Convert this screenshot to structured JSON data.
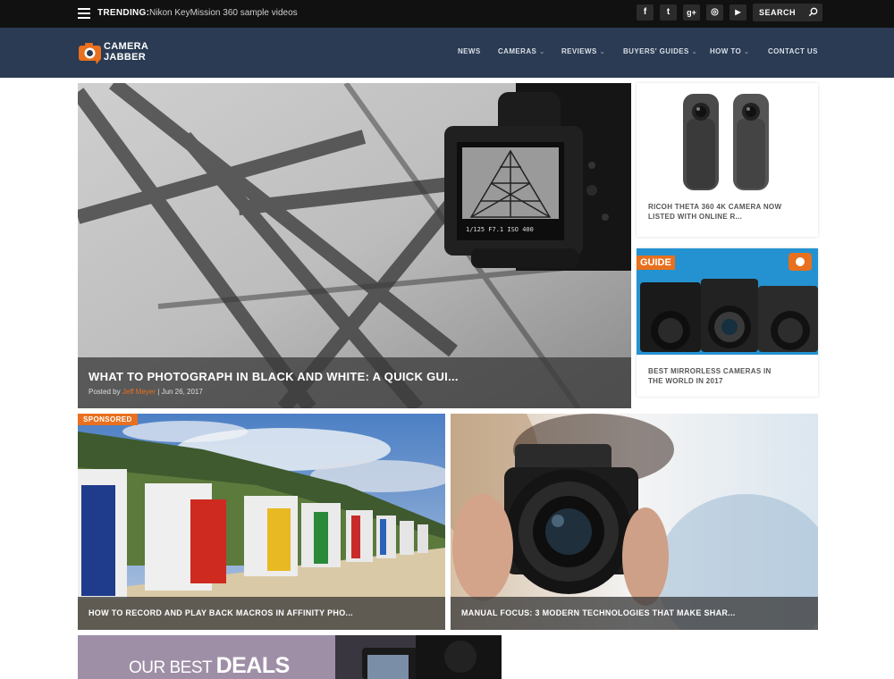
{
  "topbar": {
    "trending_label": "TRENDING:",
    "trending_text": "Nikon KeyMission 360 sample videos",
    "social": [
      {
        "name": "facebook-icon",
        "glyph": "f"
      },
      {
        "name": "twitter-icon",
        "glyph": "t"
      },
      {
        "name": "google-plus-icon",
        "glyph": "g+"
      },
      {
        "name": "instagram-icon",
        "glyph": "◎"
      },
      {
        "name": "youtube-icon",
        "glyph": "▶"
      }
    ],
    "search_label": "SEARCH"
  },
  "header": {
    "logo_line1": "CAMERA",
    "logo_line2": "JABBER",
    "nav": [
      {
        "label": "NEWS",
        "dropdown": false
      },
      {
        "label": "CAMERAS",
        "dropdown": true
      },
      {
        "label": "REVIEWS",
        "dropdown": true
      },
      {
        "label": "BUYERS' GUIDES",
        "dropdown": true
      },
      {
        "label": "HOW TO",
        "dropdown": true
      },
      {
        "label": "CONTACT US",
        "dropdown": false
      }
    ],
    "chevron": "⌄"
  },
  "featured": {
    "title": "WHAT TO PHOTOGRAPH IN BLACK AND WHITE: A QUICK GUI...",
    "posted_by": "Posted by",
    "author": "Jeff Meyer",
    "date": "Jun 26, 2017",
    "screen_readout": "1/125  F7.1  ISO 400"
  },
  "side": [
    {
      "title_line1": "RICOH THETA 360 4K CAMERA NOW",
      "title_line2": "LISTED WITH ONLINE R..."
    },
    {
      "tag": "GUIDE",
      "title_line1": "BEST MIRRORLESS CAMERAS IN",
      "title_line2": "THE WORLD IN 2017"
    }
  ],
  "row2": [
    {
      "tag": "SPONSORED",
      "title": "HOW TO RECORD AND PLAY BACK MACROS IN AFFINITY PHO..."
    },
    {
      "title": "MANUAL FOCUS: 3 MODERN TECHNOLOGIES THAT MAKE SHAR..."
    }
  ],
  "deals": {
    "prefix": "OUR BEST",
    "word": "DEALS"
  },
  "colors": {
    "accent": "#e8701e",
    "header": "#2a3b53",
    "topbar": "#111111"
  }
}
